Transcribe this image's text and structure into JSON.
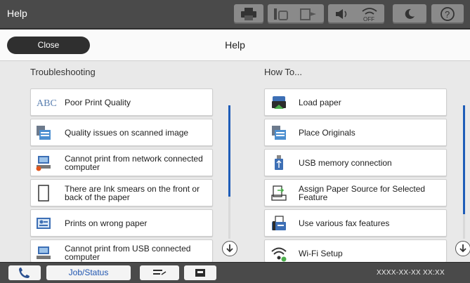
{
  "topbar": {
    "title": "Help"
  },
  "header": {
    "close_label": "Close",
    "title": "Help"
  },
  "troubleshooting": {
    "heading": "Troubleshooting",
    "items": [
      {
        "label": "Poor Print Quality",
        "icon": "abc-text-icon"
      },
      {
        "label": "Quality issues on scanned image",
        "icon": "scanned-image-icon"
      },
      {
        "label": "Cannot print from network connected computer",
        "icon": "network-computer-error-icon"
      },
      {
        "label": "There are Ink smears on the front or back of the paper",
        "icon": "paper-sheet-icon"
      },
      {
        "label": "Prints on wrong paper",
        "icon": "wrong-paper-icon"
      },
      {
        "label": "Cannot print from USB connected computer",
        "icon": "usb-computer-error-icon"
      }
    ]
  },
  "howto": {
    "heading": "How To...",
    "items": [
      {
        "label": "Load paper",
        "icon": "load-paper-icon"
      },
      {
        "label": "Place Originals",
        "icon": "place-originals-icon"
      },
      {
        "label": "USB memory connection",
        "icon": "usb-memory-icon"
      },
      {
        "label": "Assign Paper Source for Selected Feature",
        "icon": "paper-source-icon"
      },
      {
        "label": "Use various fax features",
        "icon": "fax-icon"
      },
      {
        "label": "Wi-Fi Setup",
        "icon": "wifi-setup-icon"
      }
    ]
  },
  "bottombar": {
    "job_status_label": "Job/Status",
    "datetime": "XXXX-XX-XX XX:XX"
  },
  "colors": {
    "topbar": "#4a4a4a",
    "accent": "#1f5db8",
    "close_button": "#2f2f2f"
  }
}
